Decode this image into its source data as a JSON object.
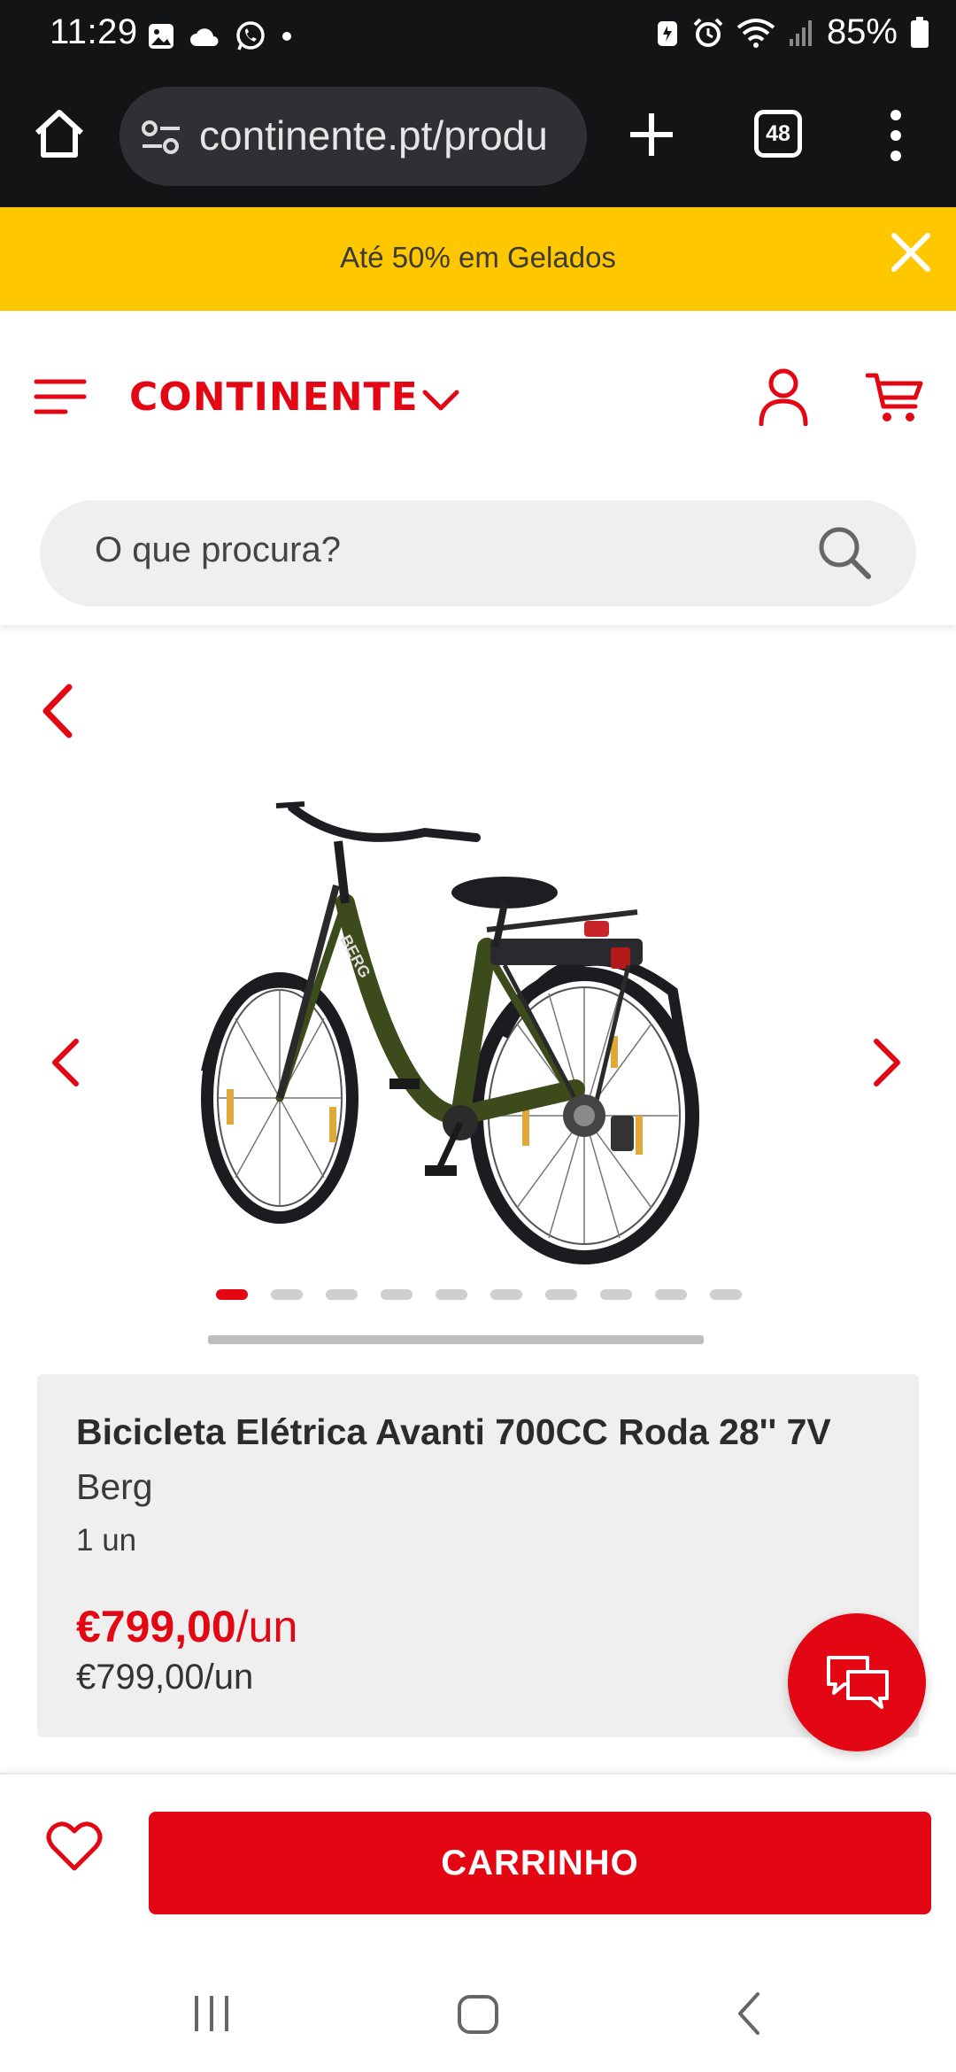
{
  "status_bar": {
    "time": "11:29",
    "battery": "85%"
  },
  "browser": {
    "url": "continente.pt/produ",
    "tab_count": "48"
  },
  "promo": {
    "text": "Até 50% em Gelados"
  },
  "header": {
    "logo": "CONTINENTE",
    "search_placeholder": "O que procura?"
  },
  "gallery": {
    "image_count": 10,
    "active_index": 0
  },
  "product": {
    "title": "Bicicleta Elétrica Avanti 700CC Roda 28'' 7V",
    "brand": "Berg",
    "unit": "1 un",
    "price": "€799,00",
    "price_unit": "/un",
    "price_secondary": "€799,00/un",
    "frame_label": "BERG"
  },
  "actions": {
    "cart_label": "CARRINHO"
  },
  "colors": {
    "brand_red": "#e30613",
    "promo_yellow": "#ffc700",
    "bike_frame": "#3d4a1c"
  }
}
